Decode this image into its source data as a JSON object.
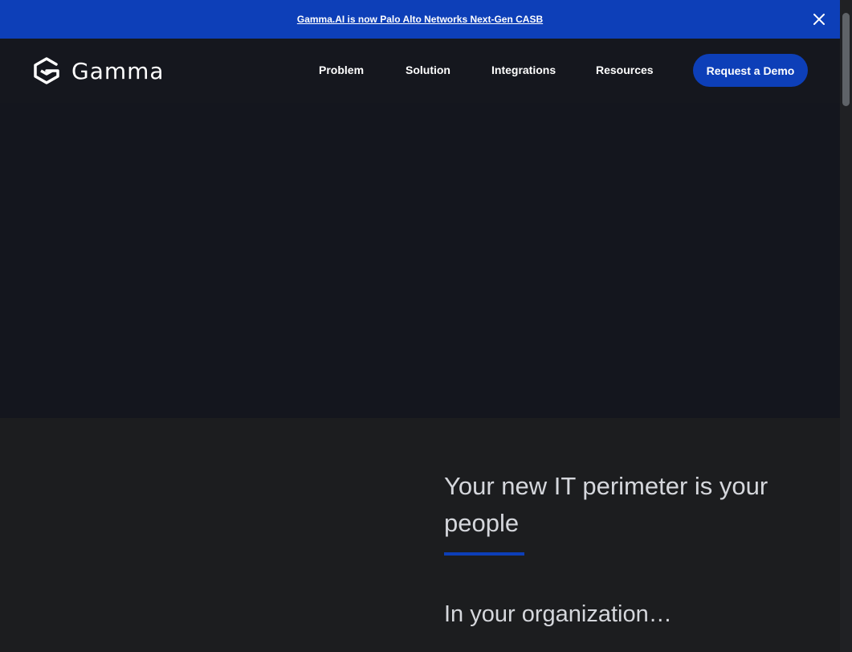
{
  "banner": {
    "link_text": "Gamma.AI is now Palo Alto Networks Next-Gen CASB",
    "close_icon": "close-icon"
  },
  "header": {
    "logo_text": "Gamma",
    "logo_icon": "hexagon-g-icon",
    "nav": [
      {
        "label": "Problem"
      },
      {
        "label": "Solution"
      },
      {
        "label": "Integrations"
      },
      {
        "label": "Resources"
      }
    ],
    "cta_label": "Request a Demo"
  },
  "content": {
    "headline": "Your new IT perimeter is your people",
    "subheading": "In your organization…"
  },
  "colors": {
    "brand_blue": "#0d3fb8",
    "header_bg": "#15171e",
    "hero_bg": "#14161e",
    "section_bg": "#1c1d1f",
    "text_light": "#d5d7dc"
  }
}
